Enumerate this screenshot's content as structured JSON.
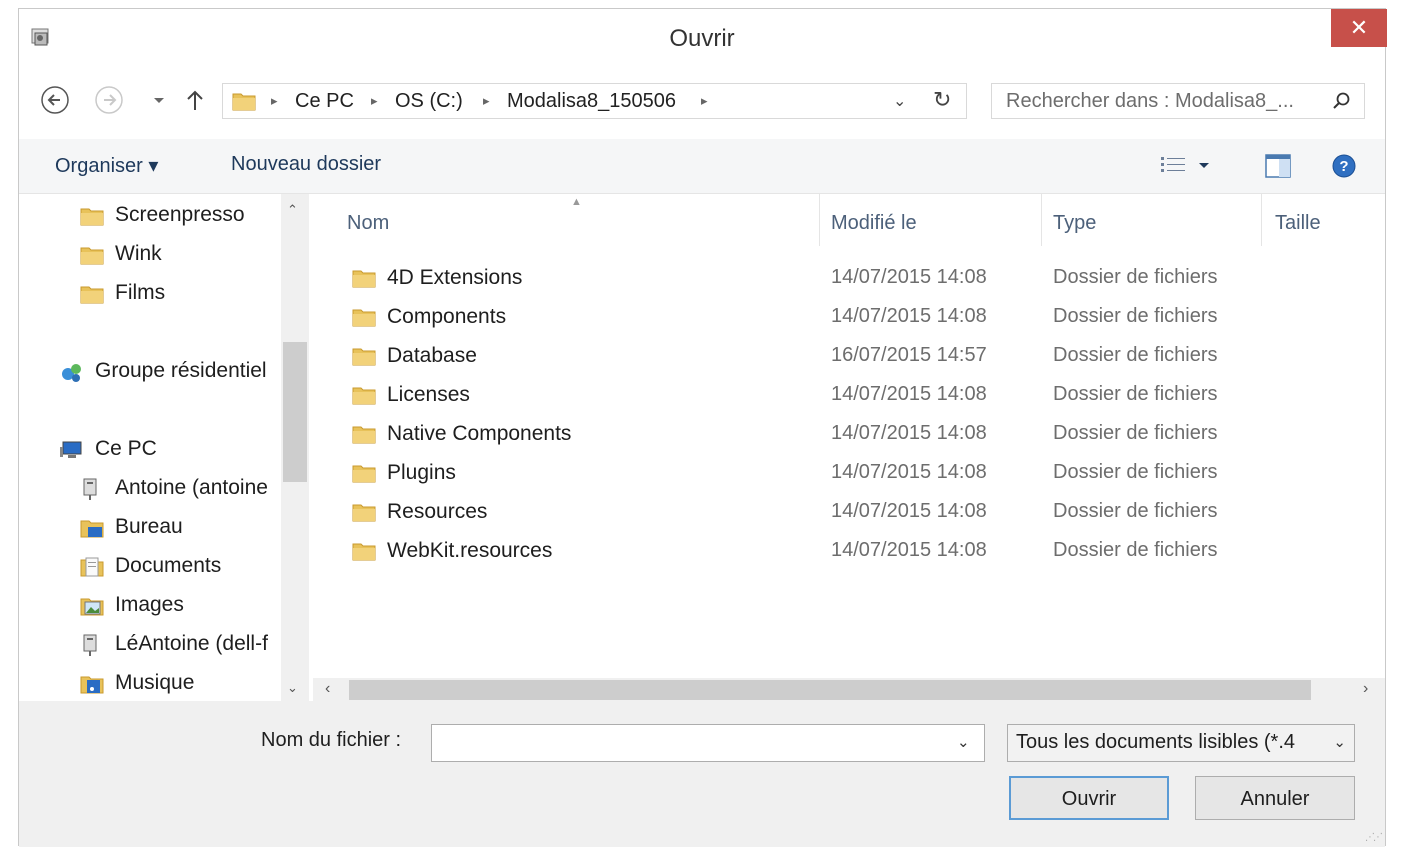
{
  "window": {
    "title": "Ouvrir",
    "close_glyph": "✕"
  },
  "address": {
    "crumbs": [
      "Ce PC",
      "OS (C:)",
      "Modalisa8_150506"
    ],
    "dropdown_glyph": "⌄",
    "refresh_glyph": "↻"
  },
  "search": {
    "placeholder": "Rechercher dans : Modalisa8_..."
  },
  "toolbar": {
    "organize_label": "Organiser ▾",
    "new_folder_label": "Nouveau dossier"
  },
  "nav_pane": {
    "items": [
      {
        "label": "Screenpresso",
        "icon": "folder-icon"
      },
      {
        "label": "Wink",
        "icon": "folder-icon"
      },
      {
        "label": "Films",
        "icon": "folder-icon"
      },
      {
        "label": "Groupe résidentiel",
        "icon": "homegroup-icon"
      },
      {
        "label": "Ce PC",
        "icon": "computer-icon"
      },
      {
        "label": "Antoine (antoine",
        "icon": "network-drive-icon"
      },
      {
        "label": "Bureau",
        "icon": "desktop-folder-icon"
      },
      {
        "label": "Documents",
        "icon": "documents-folder-icon"
      },
      {
        "label": "Images",
        "icon": "images-folder-icon"
      },
      {
        "label": "LéAntoine (dell-f",
        "icon": "network-drive-icon"
      },
      {
        "label": "Musique",
        "icon": "music-folder-icon"
      }
    ]
  },
  "file_list": {
    "columns": [
      "Nom",
      "Modifié le",
      "Type",
      "Taille"
    ],
    "rows": [
      {
        "name": "4D Extensions",
        "modified": "14/07/2015 14:08",
        "type": "Dossier de fichiers"
      },
      {
        "name": "Components",
        "modified": "14/07/2015 14:08",
        "type": "Dossier de fichiers"
      },
      {
        "name": "Database",
        "modified": "16/07/2015 14:57",
        "type": "Dossier de fichiers"
      },
      {
        "name": "Licenses",
        "modified": "14/07/2015 14:08",
        "type": "Dossier de fichiers"
      },
      {
        "name": "Native Components",
        "modified": "14/07/2015 14:08",
        "type": "Dossier de fichiers"
      },
      {
        "name": "Plugins",
        "modified": "14/07/2015 14:08",
        "type": "Dossier de fichiers"
      },
      {
        "name": "Resources",
        "modified": "14/07/2015 14:08",
        "type": "Dossier de fichiers"
      },
      {
        "name": "WebKit.resources",
        "modified": "14/07/2015 14:08",
        "type": "Dossier de fichiers"
      }
    ]
  },
  "bottom": {
    "filename_label": "Nom du fichier :",
    "filename_value": "",
    "filter_value": "Tous les documents lisibles (*.4",
    "open_label": "Ouvrir",
    "cancel_label": "Annuler"
  },
  "colors": {
    "close_red": "#c7504a",
    "folder_yellow": "#e8c25a",
    "header_text": "#4c607a",
    "default_button_border": "#5b9bd5"
  }
}
